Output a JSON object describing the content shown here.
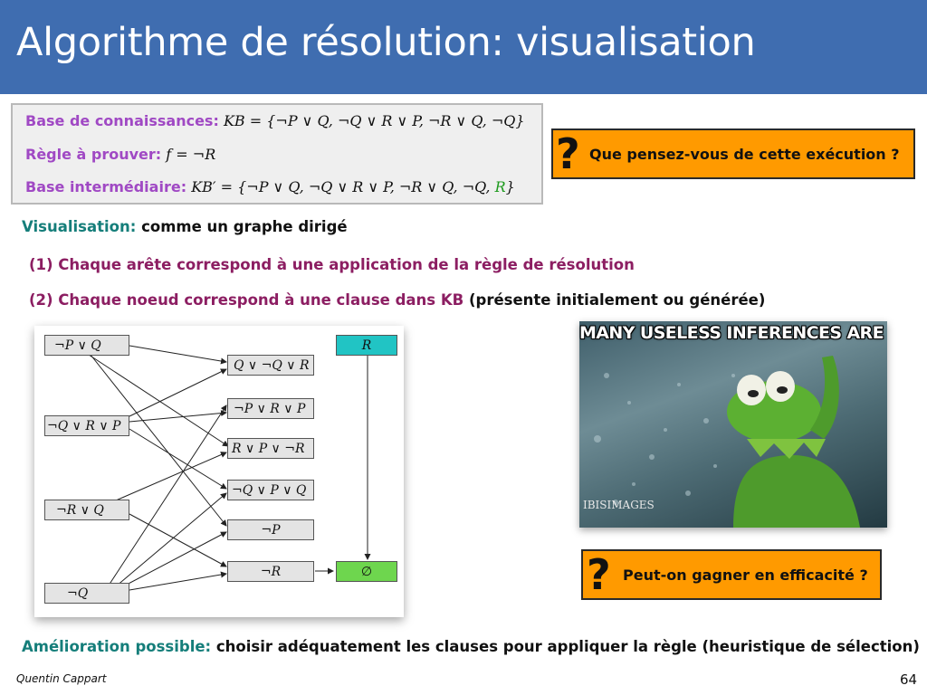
{
  "slide": {
    "title": "Algorithme de résolution: visualisation",
    "page_number": "64",
    "author": "Quentin Cappart"
  },
  "kb_box": {
    "base_label": "Base de connaissances:",
    "base_formula": "KB = {¬P ∨ Q, ¬Q ∨ R ∨ P, ¬R ∨ Q, ¬Q}",
    "rule_label": "Règle à prouver:",
    "rule_formula": "f = ¬R",
    "inter_label": "Base intermédiaire:",
    "inter_formula_prefix": "KB′ = {¬P ∨ Q, ¬Q ∨ R ∨ P, ¬R ∨ Q, ¬Q, ",
    "inter_formula_added": "R",
    "inter_formula_suffix": "}"
  },
  "callouts": {
    "question1": "Que pensez-vous de cette exécution ?",
    "question2": "Peut-on gagner en efficacité ?",
    "qmark": "?"
  },
  "body": {
    "visualisation_label": "Visualisation:",
    "visualisation_text": "comme un graphe dirigé",
    "point1": "(1) Chaque arête correspond à une application de la règle de résolution",
    "point2_main": "(2) Chaque noeud correspond à une clause dans KB",
    "point2_paren": "(présente initialement ou générée)",
    "improvement_label": "Amélioration possible:",
    "improvement_text": "choisir adéquatement les clauses pour appliquer la règle (heuristique de sélection)"
  },
  "graph": {
    "nodes": {
      "n1": "¬P ∨ Q",
      "n2": "¬Q ∨ R ∨ P",
      "n3": "¬R ∨ Q",
      "n4": "¬Q",
      "r": "R",
      "m1": "Q ∨ ¬Q ∨ R",
      "m2": "¬P ∨ R ∨ P",
      "m3": "R ∨ P ∨ ¬R",
      "m4": "¬Q ∨ P ∨ Q",
      "m5": "¬P",
      "m6": "¬R",
      "empty": "∅"
    },
    "colors": {
      "clause": "#e4e4e4",
      "goal": "#21c4c4",
      "empty": "#6ed64e"
    }
  },
  "meme": {
    "caption": "MANY USELESS INFERENCES ARE DONE",
    "watermark": "IBISIMAGES"
  },
  "colors": {
    "title_bar": "#3f6db0",
    "label_purple": "#a049c4",
    "teal": "#157e7a",
    "maroon": "#8c1e62",
    "callout_orange": "#ff9a00",
    "added_clause_green": "#1e9a1e"
  }
}
